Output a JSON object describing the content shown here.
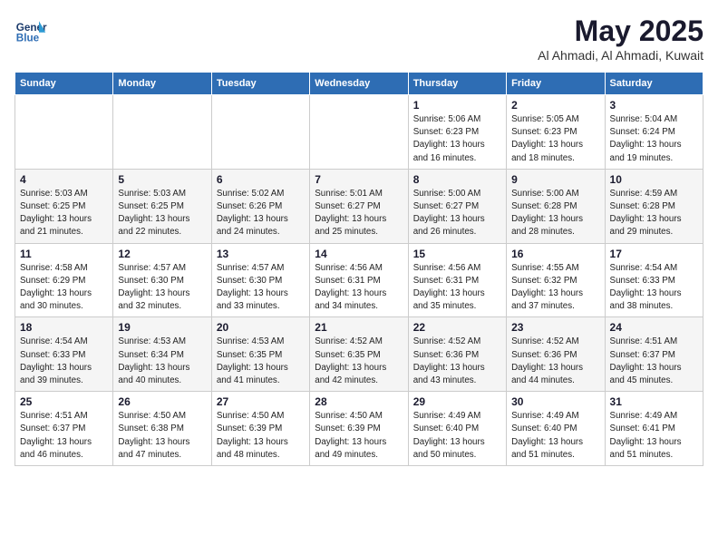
{
  "header": {
    "logo_line1": "General",
    "logo_line2": "Blue",
    "month": "May 2025",
    "location": "Al Ahmadi, Al Ahmadi, Kuwait"
  },
  "days_of_week": [
    "Sunday",
    "Monday",
    "Tuesday",
    "Wednesday",
    "Thursday",
    "Friday",
    "Saturday"
  ],
  "weeks": [
    [
      {
        "num": "",
        "info": ""
      },
      {
        "num": "",
        "info": ""
      },
      {
        "num": "",
        "info": ""
      },
      {
        "num": "",
        "info": ""
      },
      {
        "num": "1",
        "info": "Sunrise: 5:06 AM\nSunset: 6:23 PM\nDaylight: 13 hours\nand 16 minutes."
      },
      {
        "num": "2",
        "info": "Sunrise: 5:05 AM\nSunset: 6:23 PM\nDaylight: 13 hours\nand 18 minutes."
      },
      {
        "num": "3",
        "info": "Sunrise: 5:04 AM\nSunset: 6:24 PM\nDaylight: 13 hours\nand 19 minutes."
      }
    ],
    [
      {
        "num": "4",
        "info": "Sunrise: 5:03 AM\nSunset: 6:25 PM\nDaylight: 13 hours\nand 21 minutes."
      },
      {
        "num": "5",
        "info": "Sunrise: 5:03 AM\nSunset: 6:25 PM\nDaylight: 13 hours\nand 22 minutes."
      },
      {
        "num": "6",
        "info": "Sunrise: 5:02 AM\nSunset: 6:26 PM\nDaylight: 13 hours\nand 24 minutes."
      },
      {
        "num": "7",
        "info": "Sunrise: 5:01 AM\nSunset: 6:27 PM\nDaylight: 13 hours\nand 25 minutes."
      },
      {
        "num": "8",
        "info": "Sunrise: 5:00 AM\nSunset: 6:27 PM\nDaylight: 13 hours\nand 26 minutes."
      },
      {
        "num": "9",
        "info": "Sunrise: 5:00 AM\nSunset: 6:28 PM\nDaylight: 13 hours\nand 28 minutes."
      },
      {
        "num": "10",
        "info": "Sunrise: 4:59 AM\nSunset: 6:28 PM\nDaylight: 13 hours\nand 29 minutes."
      }
    ],
    [
      {
        "num": "11",
        "info": "Sunrise: 4:58 AM\nSunset: 6:29 PM\nDaylight: 13 hours\nand 30 minutes."
      },
      {
        "num": "12",
        "info": "Sunrise: 4:57 AM\nSunset: 6:30 PM\nDaylight: 13 hours\nand 32 minutes."
      },
      {
        "num": "13",
        "info": "Sunrise: 4:57 AM\nSunset: 6:30 PM\nDaylight: 13 hours\nand 33 minutes."
      },
      {
        "num": "14",
        "info": "Sunrise: 4:56 AM\nSunset: 6:31 PM\nDaylight: 13 hours\nand 34 minutes."
      },
      {
        "num": "15",
        "info": "Sunrise: 4:56 AM\nSunset: 6:31 PM\nDaylight: 13 hours\nand 35 minutes."
      },
      {
        "num": "16",
        "info": "Sunrise: 4:55 AM\nSunset: 6:32 PM\nDaylight: 13 hours\nand 37 minutes."
      },
      {
        "num": "17",
        "info": "Sunrise: 4:54 AM\nSunset: 6:33 PM\nDaylight: 13 hours\nand 38 minutes."
      }
    ],
    [
      {
        "num": "18",
        "info": "Sunrise: 4:54 AM\nSunset: 6:33 PM\nDaylight: 13 hours\nand 39 minutes."
      },
      {
        "num": "19",
        "info": "Sunrise: 4:53 AM\nSunset: 6:34 PM\nDaylight: 13 hours\nand 40 minutes."
      },
      {
        "num": "20",
        "info": "Sunrise: 4:53 AM\nSunset: 6:35 PM\nDaylight: 13 hours\nand 41 minutes."
      },
      {
        "num": "21",
        "info": "Sunrise: 4:52 AM\nSunset: 6:35 PM\nDaylight: 13 hours\nand 42 minutes."
      },
      {
        "num": "22",
        "info": "Sunrise: 4:52 AM\nSunset: 6:36 PM\nDaylight: 13 hours\nand 43 minutes."
      },
      {
        "num": "23",
        "info": "Sunrise: 4:52 AM\nSunset: 6:36 PM\nDaylight: 13 hours\nand 44 minutes."
      },
      {
        "num": "24",
        "info": "Sunrise: 4:51 AM\nSunset: 6:37 PM\nDaylight: 13 hours\nand 45 minutes."
      }
    ],
    [
      {
        "num": "25",
        "info": "Sunrise: 4:51 AM\nSunset: 6:37 PM\nDaylight: 13 hours\nand 46 minutes."
      },
      {
        "num": "26",
        "info": "Sunrise: 4:50 AM\nSunset: 6:38 PM\nDaylight: 13 hours\nand 47 minutes."
      },
      {
        "num": "27",
        "info": "Sunrise: 4:50 AM\nSunset: 6:39 PM\nDaylight: 13 hours\nand 48 minutes."
      },
      {
        "num": "28",
        "info": "Sunrise: 4:50 AM\nSunset: 6:39 PM\nDaylight: 13 hours\nand 49 minutes."
      },
      {
        "num": "29",
        "info": "Sunrise: 4:49 AM\nSunset: 6:40 PM\nDaylight: 13 hours\nand 50 minutes."
      },
      {
        "num": "30",
        "info": "Sunrise: 4:49 AM\nSunset: 6:40 PM\nDaylight: 13 hours\nand 51 minutes."
      },
      {
        "num": "31",
        "info": "Sunrise: 4:49 AM\nSunset: 6:41 PM\nDaylight: 13 hours\nand 51 minutes."
      }
    ]
  ]
}
